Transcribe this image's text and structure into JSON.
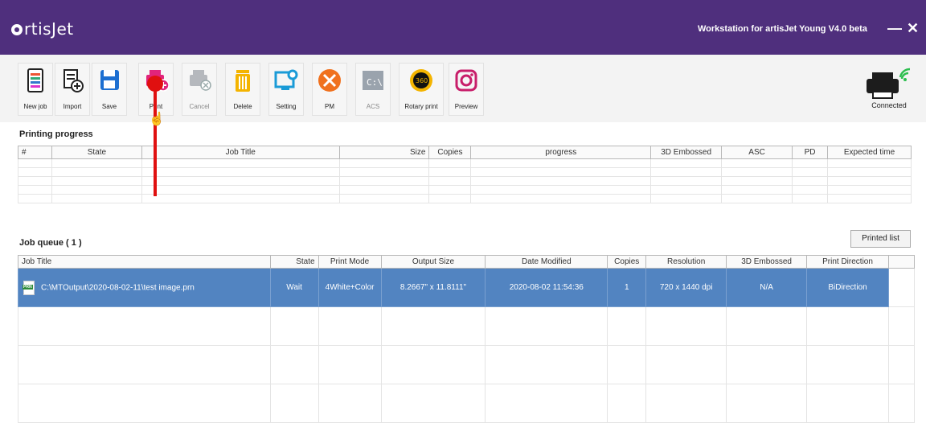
{
  "app": {
    "logo": "rtisJet",
    "window_title": "Workstation for artisJet Young V4.0 beta",
    "minimize": "—",
    "close": "✕"
  },
  "toolbar": {
    "new_job": "New job",
    "import": "Import",
    "save": "Save",
    "print": "Print",
    "cancel": "Cancel",
    "delete": "Delete",
    "setting": "Setting",
    "pm": "PM",
    "acs": "ACS",
    "rotary": "Rotary print",
    "rotary_badge": "360",
    "preview": "Preview"
  },
  "status": {
    "connected": "Connected"
  },
  "printing": {
    "title": "Printing progress",
    "columns": [
      "#",
      "State",
      "Job Title",
      "Size",
      "Copies",
      "progress",
      "3D Embossed",
      "ASC",
      "PD",
      "Expected time"
    ]
  },
  "queue": {
    "title": "Job queue ( 1 )",
    "printed_list": "Printed list",
    "columns": [
      "Job Title",
      "State",
      "Print Mode",
      "Output Size",
      "Date Modified",
      "Copies",
      "Resolution",
      "3D Embossed",
      "Print Direction"
    ],
    "rows": [
      {
        "file_badge": "PRN",
        "title": "C:\\MTOutput\\2020-08-02-11\\test image.prn",
        "state": "Wait",
        "mode": "4White+Color",
        "size": "8.2667\" x 11.8111\"",
        "date": "2020-08-02 11:54:36",
        "copies": "1",
        "resolution": "720 x 1440 dpi",
        "embossed": "N/A",
        "direction": "BiDirection"
      }
    ]
  },
  "colors": {
    "titlebar": "#4f2f7d",
    "selection": "#5284c1",
    "annotation": "#e01010"
  }
}
